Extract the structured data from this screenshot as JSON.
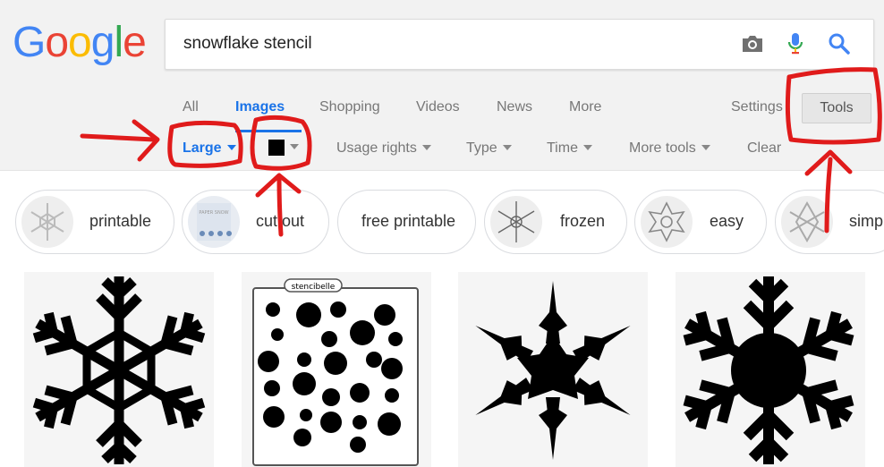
{
  "logo": {
    "letters": [
      {
        "char": "G",
        "color": "#4285F4"
      },
      {
        "char": "o",
        "color": "#EA4335"
      },
      {
        "char": "o",
        "color": "#FBBC05"
      },
      {
        "char": "g",
        "color": "#4285F4"
      },
      {
        "char": "l",
        "color": "#34A853"
      },
      {
        "char": "e",
        "color": "#EA4335"
      }
    ]
  },
  "search": {
    "query": "snowflake stencil",
    "camera_icon": "camera-icon",
    "mic_icon": "microphone-icon",
    "search_icon": "search-icon"
  },
  "tabs": [
    {
      "label": "All",
      "active": false
    },
    {
      "label": "Images",
      "active": true
    },
    {
      "label": "Shopping",
      "active": false
    },
    {
      "label": "Videos",
      "active": false
    },
    {
      "label": "News",
      "active": false
    },
    {
      "label": "More",
      "active": false
    }
  ],
  "settings_label": "Settings",
  "tools_label": "Tools",
  "filters": {
    "size": "Large",
    "color_value": "#000000",
    "usage_rights": "Usage rights",
    "type": "Type",
    "time": "Time",
    "more_tools": "More tools",
    "clear": "Clear"
  },
  "chips": [
    {
      "label": "printable"
    },
    {
      "label": "cut out"
    },
    {
      "label": "free printable"
    },
    {
      "label": "frozen"
    },
    {
      "label": "easy"
    },
    {
      "label": "simple"
    }
  ],
  "results": [
    {
      "name": "snowflake-stencil-1"
    },
    {
      "name": "snowflake-stencil-sheet"
    },
    {
      "name": "snowflake-stencil-3"
    },
    {
      "name": "snowflake-stencil-4"
    }
  ],
  "result_watermark": "stencibelle",
  "colors": {
    "accent_blue": "#1a73e8",
    "annotation_red": "#e01b1b",
    "header_bg": "#f2f2f2"
  }
}
